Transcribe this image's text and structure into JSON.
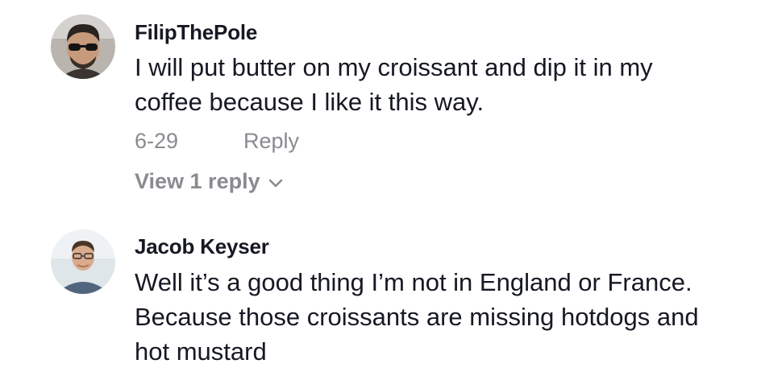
{
  "comments": [
    {
      "username": "FilipThePole",
      "text_lines": [
        "I will put butter on my croissant and dip it in my",
        "coffee because I like it this way."
      ],
      "date": "6-29",
      "reply_label": "Reply",
      "view_replies_label": "View 1 reply",
      "avatar_icon": "avatar-man-sunglasses"
    },
    {
      "username": "Jacob Keyser",
      "text_lines": [
        "Well it’s a good thing I’m not in England or France.",
        "Because those croissants are missing hotdogs and",
        "hot mustard"
      ],
      "avatar_icon": "avatar-man-glasses"
    }
  ],
  "colors": {
    "text": "#161823",
    "muted": "#8a8b91",
    "background": "#ffffff"
  }
}
